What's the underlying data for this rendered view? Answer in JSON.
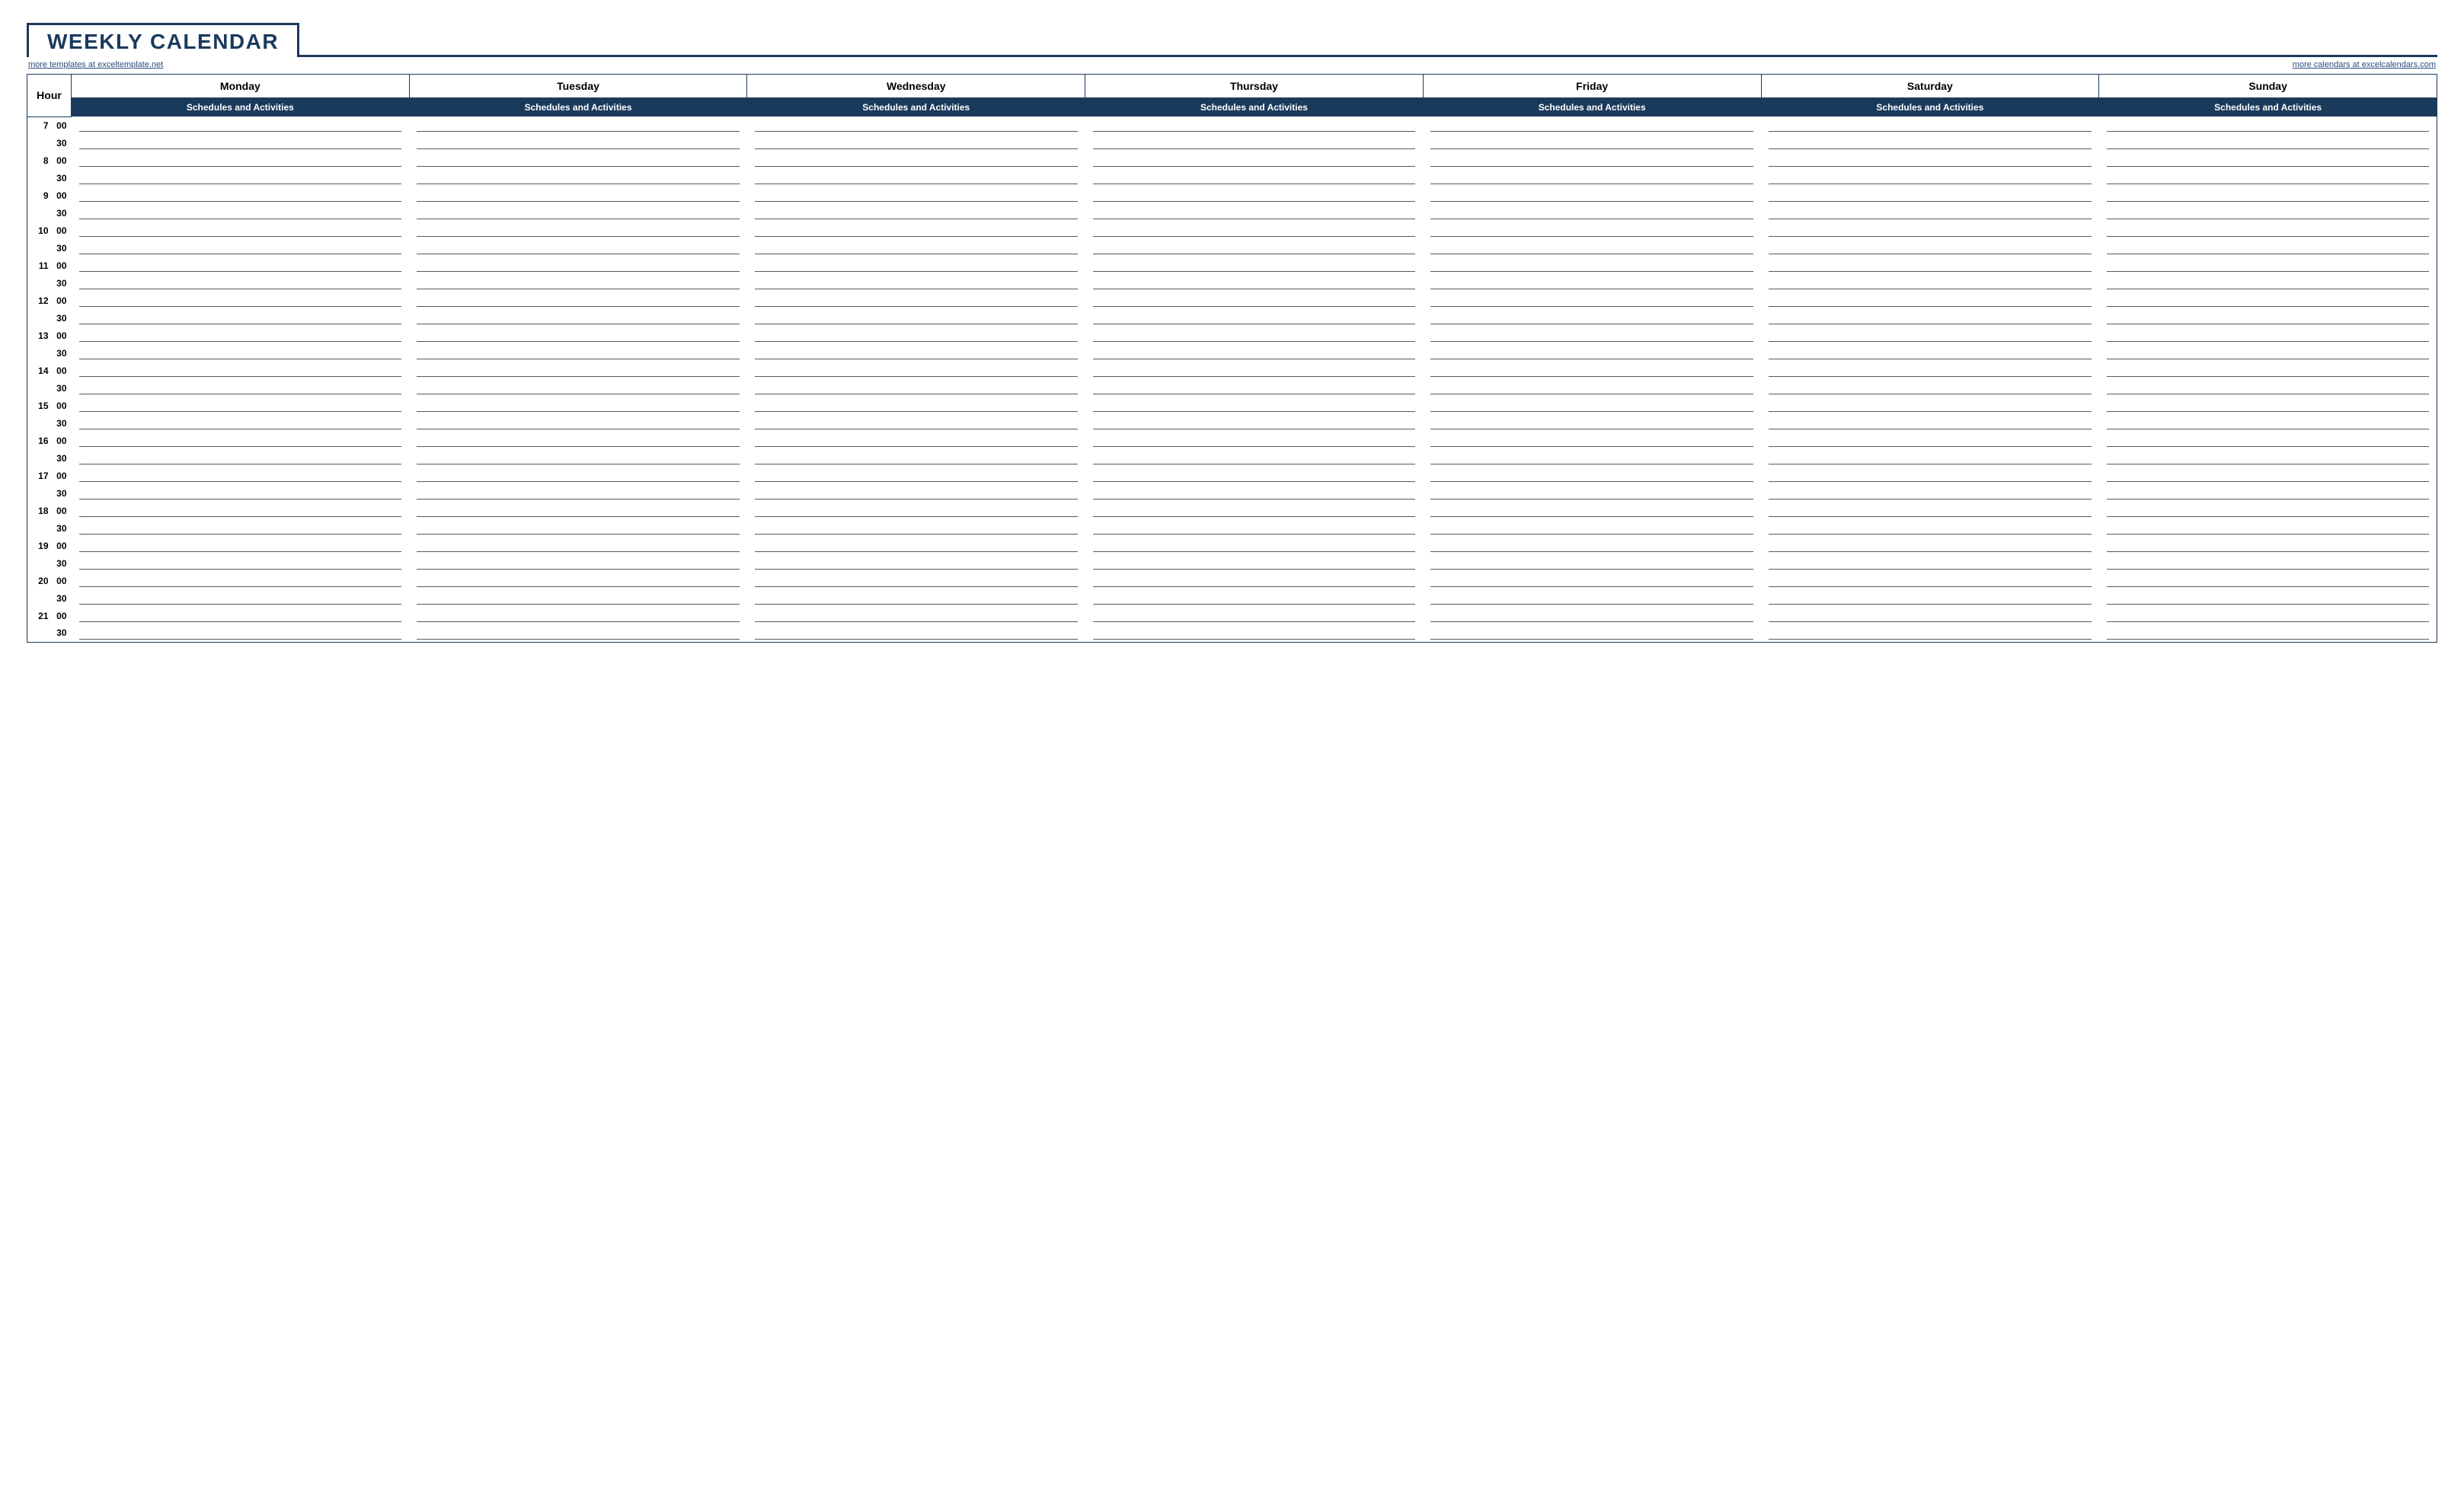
{
  "title": "WEEKLY CALENDAR",
  "links": {
    "left": "more templates at exceltemplate.net",
    "right": "more calendars at excelcalendars.com"
  },
  "headers": {
    "hour": "Hour",
    "days": [
      "Monday",
      "Tuesday",
      "Wednesday",
      "Thursday",
      "Friday",
      "Saturday",
      "Sunday"
    ],
    "subheader": "Schedules and Activities"
  },
  "time_slots": [
    {
      "hour": "7",
      "minute": "00"
    },
    {
      "hour": "",
      "minute": "30"
    },
    {
      "hour": "8",
      "minute": "00"
    },
    {
      "hour": "",
      "minute": "30"
    },
    {
      "hour": "9",
      "minute": "00"
    },
    {
      "hour": "",
      "minute": "30"
    },
    {
      "hour": "10",
      "minute": "00"
    },
    {
      "hour": "",
      "minute": "30"
    },
    {
      "hour": "11",
      "minute": "00"
    },
    {
      "hour": "",
      "minute": "30"
    },
    {
      "hour": "12",
      "minute": "00"
    },
    {
      "hour": "",
      "minute": "30"
    },
    {
      "hour": "13",
      "minute": "00"
    },
    {
      "hour": "",
      "minute": "30"
    },
    {
      "hour": "14",
      "minute": "00"
    },
    {
      "hour": "",
      "minute": "30"
    },
    {
      "hour": "15",
      "minute": "00"
    },
    {
      "hour": "",
      "minute": "30"
    },
    {
      "hour": "16",
      "minute": "00"
    },
    {
      "hour": "",
      "minute": "30"
    },
    {
      "hour": "17",
      "minute": "00"
    },
    {
      "hour": "",
      "minute": "30"
    },
    {
      "hour": "18",
      "minute": "00"
    },
    {
      "hour": "",
      "minute": "30"
    },
    {
      "hour": "19",
      "minute": "00"
    },
    {
      "hour": "",
      "minute": "30"
    },
    {
      "hour": "20",
      "minute": "00"
    },
    {
      "hour": "",
      "minute": "30"
    },
    {
      "hour": "21",
      "minute": "00"
    },
    {
      "hour": "",
      "minute": "30"
    }
  ]
}
